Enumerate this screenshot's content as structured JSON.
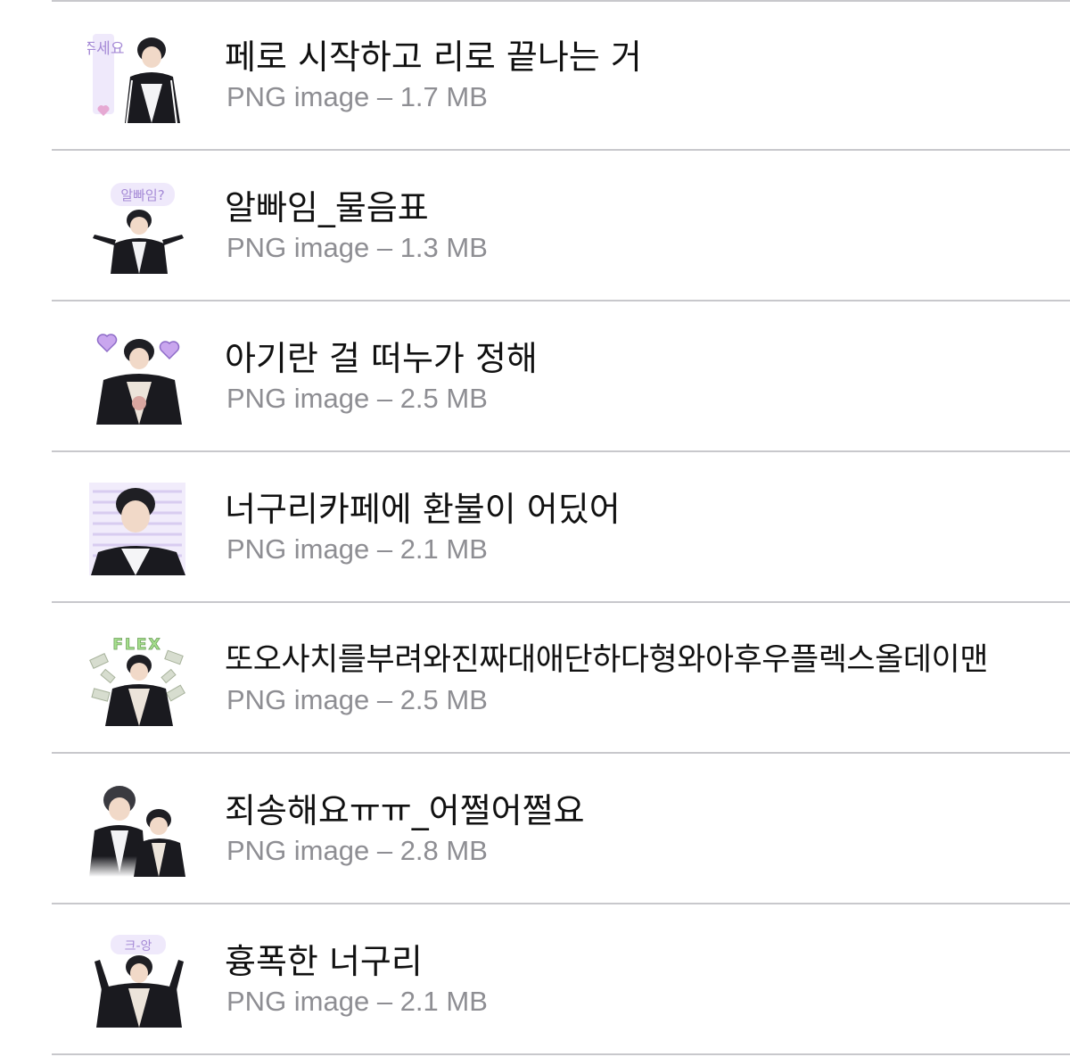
{
  "files": [
    {
      "title": "페로 시작하고 리로 끝나는 거",
      "meta": "PNG image – 1.7 MB",
      "thumbnail_icon": "sticker-thumbnail-icon",
      "sticker_text": "주세요"
    },
    {
      "title": "알빠임_물음표",
      "meta": "PNG image – 1.3 MB",
      "thumbnail_icon": "sticker-thumbnail-icon",
      "sticker_text": "알빠임?"
    },
    {
      "title": "아기란 걸 떠누가 정해",
      "meta": "PNG image – 2.5 MB",
      "thumbnail_icon": "sticker-thumbnail-icon",
      "sticker_text": ""
    },
    {
      "title": "너구리카페에 환불이 어딨어",
      "meta": "PNG image – 2.1 MB",
      "thumbnail_icon": "sticker-thumbnail-icon",
      "sticker_text": ""
    },
    {
      "title": "또오사치를부려와진짜대애단하다형와아후우플렉스올데이맨",
      "meta": "PNG image – 2.5 MB",
      "thumbnail_icon": "sticker-thumbnail-icon",
      "sticker_text": "FLEX"
    },
    {
      "title": "죄송해요ㅠㅠ_어쩔어쩔요",
      "meta": "PNG image – 2.8 MB",
      "thumbnail_icon": "sticker-thumbnail-icon",
      "sticker_text": ""
    },
    {
      "title": "흉폭한 너구리",
      "meta": "PNG image – 2.1 MB",
      "thumbnail_icon": "sticker-thumbnail-icon",
      "sticker_text": "크-앙"
    }
  ],
  "colors": {
    "title": "#111111",
    "meta": "#8e8e93",
    "divider": "#c8c8cc",
    "sticker_accent": "#b9a3e3"
  }
}
